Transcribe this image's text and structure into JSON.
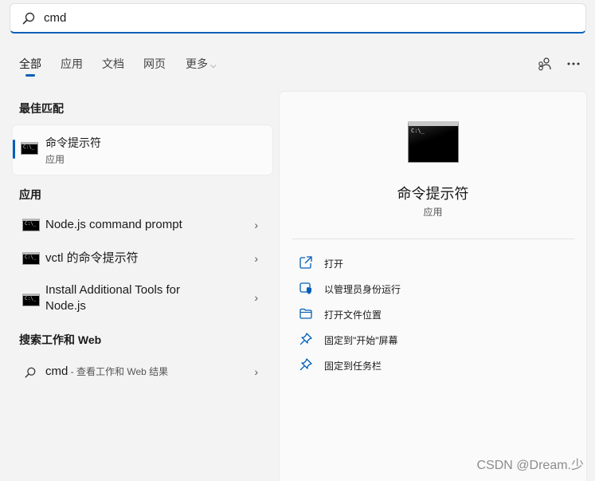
{
  "search": {
    "query": "cmd"
  },
  "tabs": [
    {
      "label": "全部"
    },
    {
      "label": "应用"
    },
    {
      "label": "文档"
    },
    {
      "label": "网页"
    },
    {
      "label": "更多"
    }
  ],
  "left": {
    "best_match_heading": "最佳匹配",
    "best_match": {
      "title": "命令提示符",
      "subtitle": "应用",
      "icon_text": "C:\\_"
    },
    "apps_heading": "应用",
    "apps": [
      {
        "label": "Node.js command prompt",
        "icon_text": "C:\\_"
      },
      {
        "label": "vctl 的命令提示符",
        "icon_text": "C:\\_"
      },
      {
        "label_line1": "Install Additional Tools for",
        "label_line2": "Node.js",
        "icon_text": "C:\\_"
      }
    ],
    "web_heading": "搜索工作和 Web",
    "web_result": {
      "query": "cmd",
      "suffix": " - 查看工作和 Web 结果"
    }
  },
  "right": {
    "app_title": "命令提示符",
    "app_subtitle": "应用",
    "icon_text": "C:\\_",
    "actions": [
      {
        "label": "打开",
        "icon": "open-external-icon"
      },
      {
        "label": "以管理员身份运行",
        "icon": "shield-admin-icon"
      },
      {
        "label": "打开文件位置",
        "icon": "folder-icon"
      },
      {
        "label": "固定到\"开始\"屏幕",
        "icon": "pin-icon"
      },
      {
        "label": "固定到任务栏",
        "icon": "pin-icon"
      }
    ]
  },
  "watermark": "CSDN @Dream.少",
  "colors": {
    "accent": "#005fb8",
    "background": "#f3f3f3",
    "panel": "#fafafa"
  }
}
